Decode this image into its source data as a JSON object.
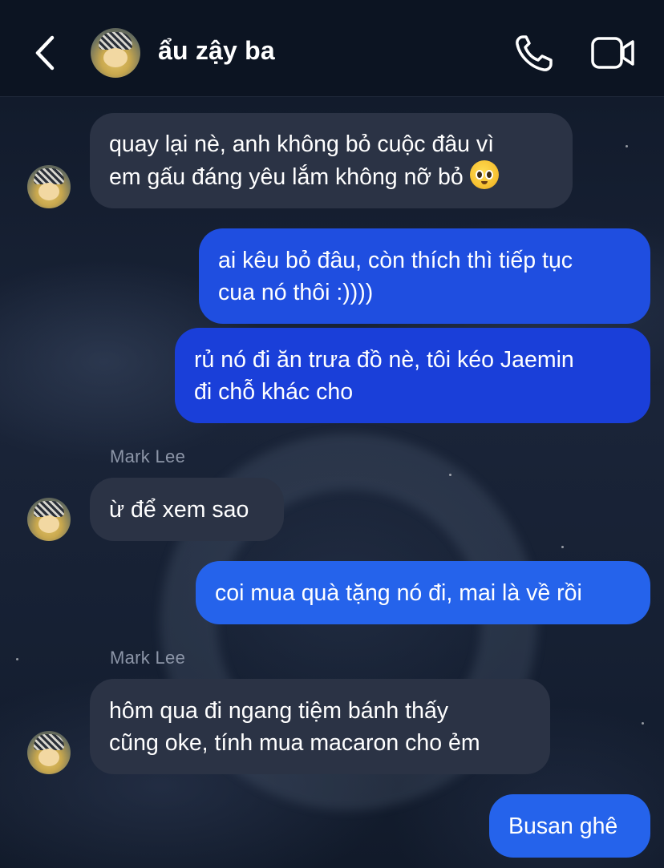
{
  "header": {
    "contact_name": "ẩu zậy ba",
    "back_icon": "chevron-left-icon",
    "call_icon": "phone-icon",
    "video_icon": "video-camera-icon"
  },
  "messages": [
    {
      "direction": "incoming",
      "text": "quay lại nè, anh không bỏ cuộc đâu vì\nem gấu đáng yêu lắm không nỡ bỏ",
      "emoji": "pleading-face-icon"
    },
    {
      "direction": "outgoing",
      "text": "ai kêu bỏ đâu, còn thích thì tiếp tục\ncua nó thôi :))))"
    },
    {
      "direction": "outgoing",
      "text": "rủ nó đi ăn trưa đồ nè, tôi kéo Jaemin\nđi chỗ khác cho"
    },
    {
      "direction": "incoming",
      "sender": "Mark Lee",
      "text": "ừ để xem sao"
    },
    {
      "direction": "outgoing",
      "text": "coi mua quà tặng nó đi, mai là về rồi"
    },
    {
      "direction": "incoming",
      "sender": "Mark Lee",
      "text": "hôm qua đi ngang tiệm bánh thấy\ncũng oke, tính mua macaron cho ẻm"
    },
    {
      "direction": "outgoing",
      "text": "Busan ghê"
    }
  ],
  "colors": {
    "incoming_bubble": "#2b3345",
    "outgoing_bubble": "#1f4ee0",
    "header_bg": "#0c1422",
    "sender_label": "#8d96a8"
  }
}
